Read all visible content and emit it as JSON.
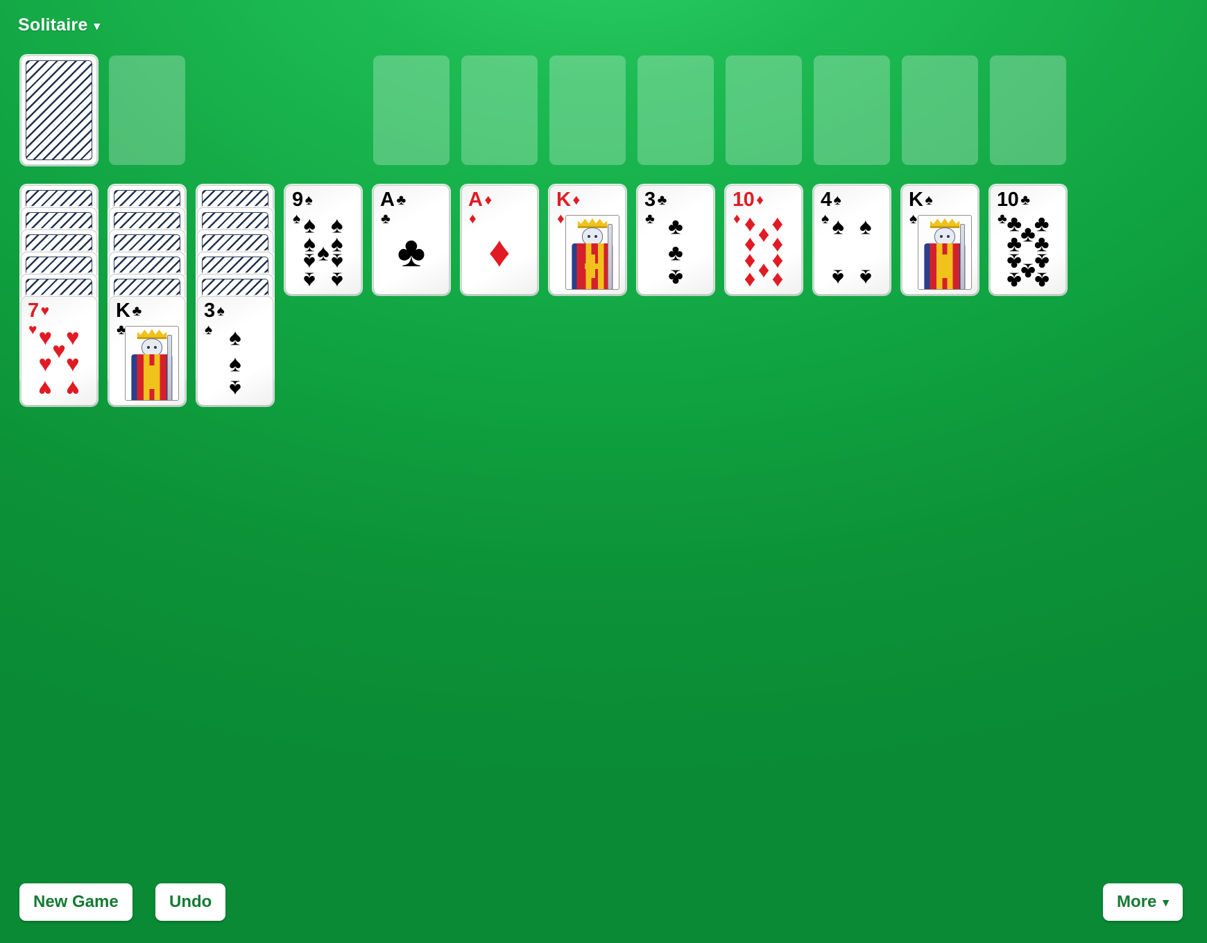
{
  "app": {
    "title": "Solitaire",
    "title_caret": "▾",
    "background_color": "#12a03f",
    "accent_color": "#147a33",
    "slot_color": "rgba(255,255,255,0.26)",
    "red_suit_color": "#e01b24",
    "black_suit_color": "#000000"
  },
  "glyphs": {
    "spade": "♠",
    "heart": "♥",
    "diamond": "♦",
    "club": "♣"
  },
  "stock": {
    "name": "stock-pile",
    "face_down_count": 1,
    "label": "stock"
  },
  "waste": {
    "name": "waste-pile",
    "empty": true,
    "label": "waste"
  },
  "free_slots": [
    {
      "label": "slot-1"
    },
    {
      "label": "slot-2"
    },
    {
      "label": "slot-3"
    },
    {
      "label": "slot-4"
    },
    {
      "label": "slot-5"
    },
    {
      "label": "slot-6"
    },
    {
      "label": "slot-7"
    },
    {
      "label": "slot-8"
    }
  ],
  "tableau": [
    {
      "column": 1,
      "face_down": 5,
      "face_up": [
        {
          "rank": "7",
          "suit": "heart",
          "color": "red"
        }
      ]
    },
    {
      "column": 2,
      "face_down": 5,
      "face_up": [
        {
          "rank": "K",
          "suit": "club",
          "color": "black",
          "court": true
        }
      ]
    },
    {
      "column": 3,
      "face_down": 5,
      "face_up": [
        {
          "rank": "3",
          "suit": "spade",
          "color": "black"
        }
      ]
    },
    {
      "column": 4,
      "face_down": 0,
      "face_up": [
        {
          "rank": "9",
          "suit": "spade",
          "color": "black"
        }
      ]
    },
    {
      "column": 5,
      "face_down": 0,
      "face_up": [
        {
          "rank": "A",
          "suit": "club",
          "color": "black"
        }
      ]
    },
    {
      "column": 6,
      "face_down": 0,
      "face_up": [
        {
          "rank": "A",
          "suit": "diamond",
          "color": "red"
        }
      ]
    },
    {
      "column": 7,
      "face_down": 0,
      "face_up": [
        {
          "rank": "K",
          "suit": "diamond",
          "color": "red",
          "court": true
        }
      ]
    },
    {
      "column": 8,
      "face_down": 0,
      "face_up": [
        {
          "rank": "3",
          "suit": "club",
          "color": "black"
        }
      ]
    },
    {
      "column": 9,
      "face_down": 0,
      "face_up": [
        {
          "rank": "10",
          "suit": "diamond",
          "color": "red"
        }
      ]
    },
    {
      "column": 10,
      "face_down": 0,
      "face_up": [
        {
          "rank": "4",
          "suit": "spade",
          "color": "black"
        }
      ]
    },
    {
      "column": 11,
      "face_down": 0,
      "face_up": [
        {
          "rank": "K",
          "suit": "spade",
          "color": "black",
          "court": true
        }
      ]
    },
    {
      "column": 12,
      "face_down": 0,
      "face_up": [
        {
          "rank": "10",
          "suit": "club",
          "color": "black"
        }
      ]
    }
  ],
  "toolbar": {
    "new_game_label": "New Game",
    "undo_label": "Undo",
    "more_label": "More",
    "more_caret": "▾"
  }
}
